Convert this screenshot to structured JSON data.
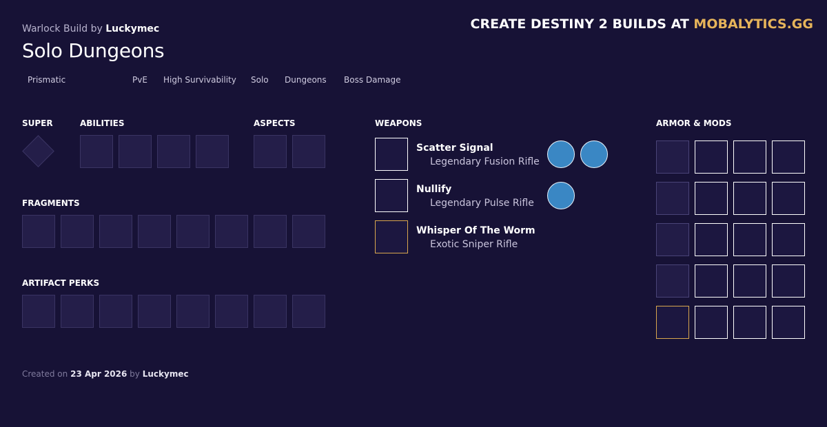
{
  "header": {
    "class_build_label": "Warlock Build by",
    "author": "Luckymec",
    "title": "Solo Dungeons",
    "promo_text": "CREATE DESTINY 2 BUILDS AT",
    "promo_site": "MOBALYTICS.GG",
    "accent_color": "#e6b45a"
  },
  "tags": [
    "Prismatic",
    "PvE",
    "High Survivability",
    "Solo",
    "Dungeons",
    "Boss Damage"
  ],
  "sections": {
    "super": "SUPER",
    "abilities": "ABILITIES",
    "aspects": "ASPECTS",
    "fragments": "FRAGMENTS",
    "artifact_perks": "ARTIFACT PERKS",
    "weapons": "WEAPONS",
    "armor_mods": "ARMOR & MODS"
  },
  "weapons": [
    {
      "name": "Scatter Signal",
      "type": "Legendary Fusion Rifle",
      "rarity": "legendary",
      "mod_count": 2
    },
    {
      "name": "Nullify",
      "type": "Legendary Pulse Rifle",
      "rarity": "legendary",
      "mod_count": 1
    },
    {
      "name": "Whisper Of The Worm",
      "type": "Exotic Sniper Rifle",
      "rarity": "exotic",
      "mod_count": 0
    }
  ],
  "footer": {
    "created_label": "Created on",
    "date": "23 Apr 2026",
    "by_label": "by",
    "author": "Luckymec"
  }
}
